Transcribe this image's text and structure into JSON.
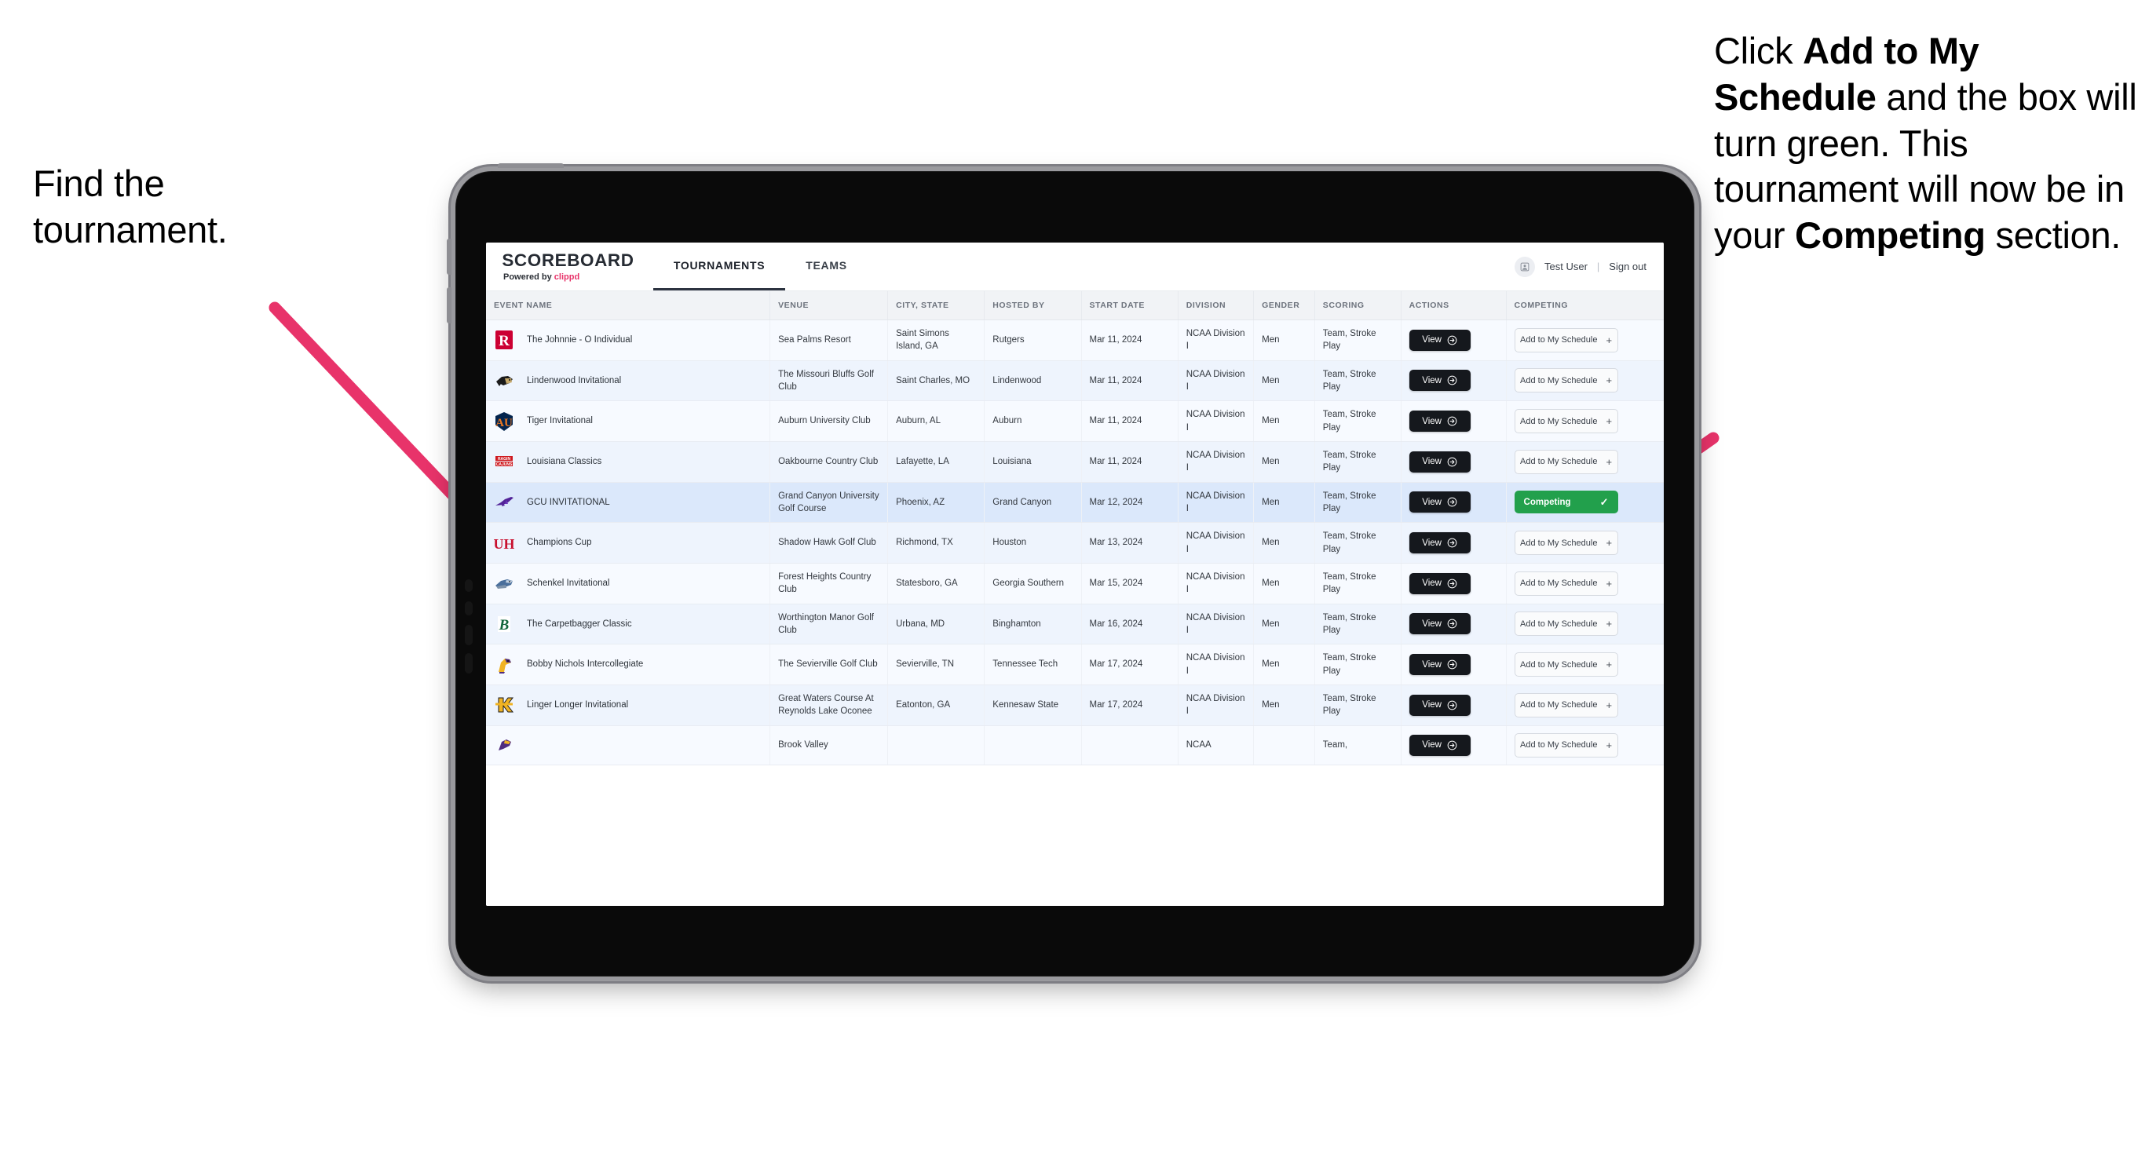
{
  "annotations": {
    "left": {
      "line1": "Find the",
      "line2": "tournament."
    },
    "right": {
      "seg1": "Click ",
      "bold1": "Add to My Schedule",
      "seg2": " and the box will turn green. This tournament will now be in your ",
      "bold2": "Competing",
      "seg3": " section."
    },
    "arrow_color": "#e8336a"
  },
  "app": {
    "brand": {
      "title": "SCOREBOARD",
      "powered_prefix": "Powered by ",
      "powered_name": "clippd"
    },
    "nav": [
      {
        "label": "TOURNAMENTS",
        "active": true
      },
      {
        "label": "TEAMS",
        "active": false
      }
    ],
    "user": {
      "avatar_icon": "user-avatar-icon",
      "name": "Test User",
      "separator": "|",
      "signout": "Sign out"
    }
  },
  "table": {
    "columns": [
      "EVENT NAME",
      "VENUE",
      "CITY, STATE",
      "HOSTED BY",
      "START DATE",
      "DIVISION",
      "GENDER",
      "SCORING",
      "ACTIONS",
      "COMPETING"
    ],
    "buttons": {
      "view": "View",
      "add": "Add to My Schedule",
      "add_plus": "+",
      "competing": "Competing",
      "competing_check": "✓"
    },
    "rows": [
      {
        "logo": "rutgers-logo",
        "event": "The Johnnie - O Individual",
        "venue": "Sea Palms Resort",
        "city": "Saint Simons Island, GA",
        "host": "Rutgers",
        "date": "Mar 11, 2024",
        "division": "NCAA Division I",
        "gender": "Men",
        "scoring": "Team, Stroke Play",
        "competing": false
      },
      {
        "logo": "lindenwood-logo",
        "event": "Lindenwood Invitational",
        "venue": "The Missouri Bluffs Golf Club",
        "city": "Saint Charles, MO",
        "host": "Lindenwood",
        "date": "Mar 11, 2024",
        "division": "NCAA Division I",
        "gender": "Men",
        "scoring": "Team, Stroke Play",
        "competing": false
      },
      {
        "logo": "auburn-logo",
        "event": "Tiger Invitational",
        "venue": "Auburn University Club",
        "city": "Auburn, AL",
        "host": "Auburn",
        "date": "Mar 11, 2024",
        "division": "NCAA Division I",
        "gender": "Men",
        "scoring": "Team, Stroke Play",
        "competing": false
      },
      {
        "logo": "louisiana-logo",
        "event": "Louisiana Classics",
        "venue": "Oakbourne Country Club",
        "city": "Lafayette, LA",
        "host": "Louisiana",
        "date": "Mar 11, 2024",
        "division": "NCAA Division I",
        "gender": "Men",
        "scoring": "Team, Stroke Play",
        "competing": false
      },
      {
        "logo": "gcu-logo",
        "event": "GCU INVITATIONAL",
        "venue": "Grand Canyon University Golf Course",
        "city": "Phoenix, AZ",
        "host": "Grand Canyon",
        "date": "Mar 12, 2024",
        "division": "NCAA Division I",
        "gender": "Men",
        "scoring": "Team, Stroke Play",
        "competing": true
      },
      {
        "logo": "houston-logo",
        "event": "Champions Cup",
        "venue": "Shadow Hawk Golf Club",
        "city": "Richmond, TX",
        "host": "Houston",
        "date": "Mar 13, 2024",
        "division": "NCAA Division I",
        "gender": "Men",
        "scoring": "Team, Stroke Play",
        "competing": false
      },
      {
        "logo": "georgia-southern-logo",
        "event": "Schenkel Invitational",
        "venue": "Forest Heights Country Club",
        "city": "Statesboro, GA",
        "host": "Georgia Southern",
        "date": "Mar 15, 2024",
        "division": "NCAA Division I",
        "gender": "Men",
        "scoring": "Team, Stroke Play",
        "competing": false
      },
      {
        "logo": "binghamton-logo",
        "event": "The Carpetbagger Classic",
        "venue": "Worthington Manor Golf Club",
        "city": "Urbana, MD",
        "host": "Binghamton",
        "date": "Mar 16, 2024",
        "division": "NCAA Division I",
        "gender": "Men",
        "scoring": "Team, Stroke Play",
        "competing": false
      },
      {
        "logo": "tennessee-tech-logo",
        "event": "Bobby Nichols Intercollegiate",
        "venue": "The Sevierville Golf Club",
        "city": "Sevierville, TN",
        "host": "Tennessee Tech",
        "date": "Mar 17, 2024",
        "division": "NCAA Division I",
        "gender": "Men",
        "scoring": "Team, Stroke Play",
        "competing": false
      },
      {
        "logo": "kennesaw-state-logo",
        "event": "Linger Longer Invitational",
        "venue": "Great Waters Course At Reynolds Lake Oconee",
        "city": "Eatonton, GA",
        "host": "Kennesaw State",
        "date": "Mar 17, 2024",
        "division": "NCAA Division I",
        "gender": "Men",
        "scoring": "Team, Stroke Play",
        "competing": false
      },
      {
        "logo": "partial-logo",
        "event": "",
        "venue": "Brook Valley",
        "city": "",
        "host": "",
        "date": "",
        "division": "NCAA",
        "gender": "",
        "scoring": "Team,",
        "competing": false,
        "cut": true
      }
    ]
  },
  "colors": {
    "accent_pink": "#e8336a",
    "competing_green": "#22a04c",
    "selected_row": "#dbe8fb",
    "dark_button": "#15181d"
  }
}
